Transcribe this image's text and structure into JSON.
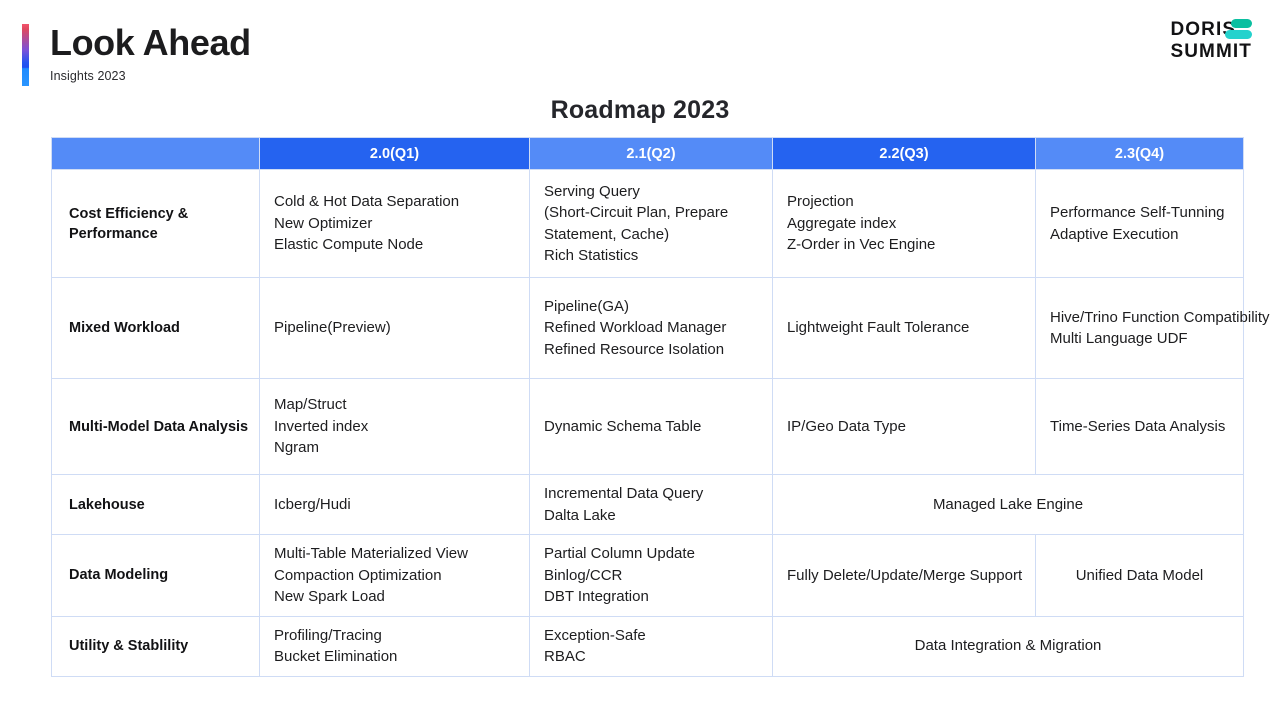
{
  "header": {
    "title": "Look Ahead",
    "subtitle": "Insights 2023",
    "accent_gradient_from": "#f2546b",
    "accent_gradient_to": "#2a95ff",
    "logo": {
      "line1": "DORIS",
      "line2": "SUMMIT",
      "mark_color_top": "#0bbfa0",
      "mark_color_bottom": "#24d2cd"
    }
  },
  "slide": {
    "title": "Roadmap 2023"
  },
  "table": {
    "header_colors": {
      "light": "#548bf7",
      "dark": "#2563f0"
    },
    "columns": [
      {
        "label": "",
        "style": "light"
      },
      {
        "label": "2.0(Q1)",
        "style": "dark"
      },
      {
        "label": "2.1(Q2)",
        "style": "light"
      },
      {
        "label": "2.2(Q3)",
        "style": "dark"
      },
      {
        "label": "2.3(Q4)",
        "style": "light"
      }
    ],
    "rows": [
      {
        "name": "Cost Efficiency & Performance",
        "q1": "Cold & Hot Data Separation\nNew Optimizer\nElastic Compute Node",
        "q2": "Serving Query\n(Short-Circuit Plan, Prepare Statement, Cache)\nRich Statistics",
        "q3": "Projection\nAggregate index\nZ-Order in Vec Engine",
        "q4": "Performance Self-Tunning\nAdaptive Execution"
      },
      {
        "name": "Mixed Workload",
        "q1": "Pipeline(Preview)",
        "q2": "Pipeline(GA)\nRefined Workload Manager\nRefined Resource Isolation",
        "q3": "Lightweight Fault Tolerance",
        "q4": "Hive/Trino Function Compatibility\nMulti Language UDF"
      },
      {
        "name": "Multi-Model Data Analysis",
        "q1": "Map/Struct\nInverted index\nNgram",
        "q2": "Dynamic Schema Table",
        "q3": "IP/Geo Data Type",
        "q4": "Time-Series Data Analysis"
      },
      {
        "name": "Lakehouse",
        "q1": "Icberg/Hudi",
        "q2": "Incremental Data Query\nDalta Lake",
        "merged_q3_q4": "Managed Lake Engine"
      },
      {
        "name": "Data Modeling",
        "q1": "Multi-Table Materialized View\nCompaction Optimization\nNew Spark Load",
        "q2": "Partial Column Update\nBinlog/CCR\nDBT Integration",
        "q3": "Fully Delete/Update/Merge Support",
        "q4": "Unified Data Model"
      },
      {
        "name": "Utility & Stablility",
        "q1": "Profiling/Tracing\nBucket Elimination",
        "q2": "Exception-Safe\nRBAC",
        "merged_q3_q4": "Data Integration & Migration"
      }
    ]
  }
}
